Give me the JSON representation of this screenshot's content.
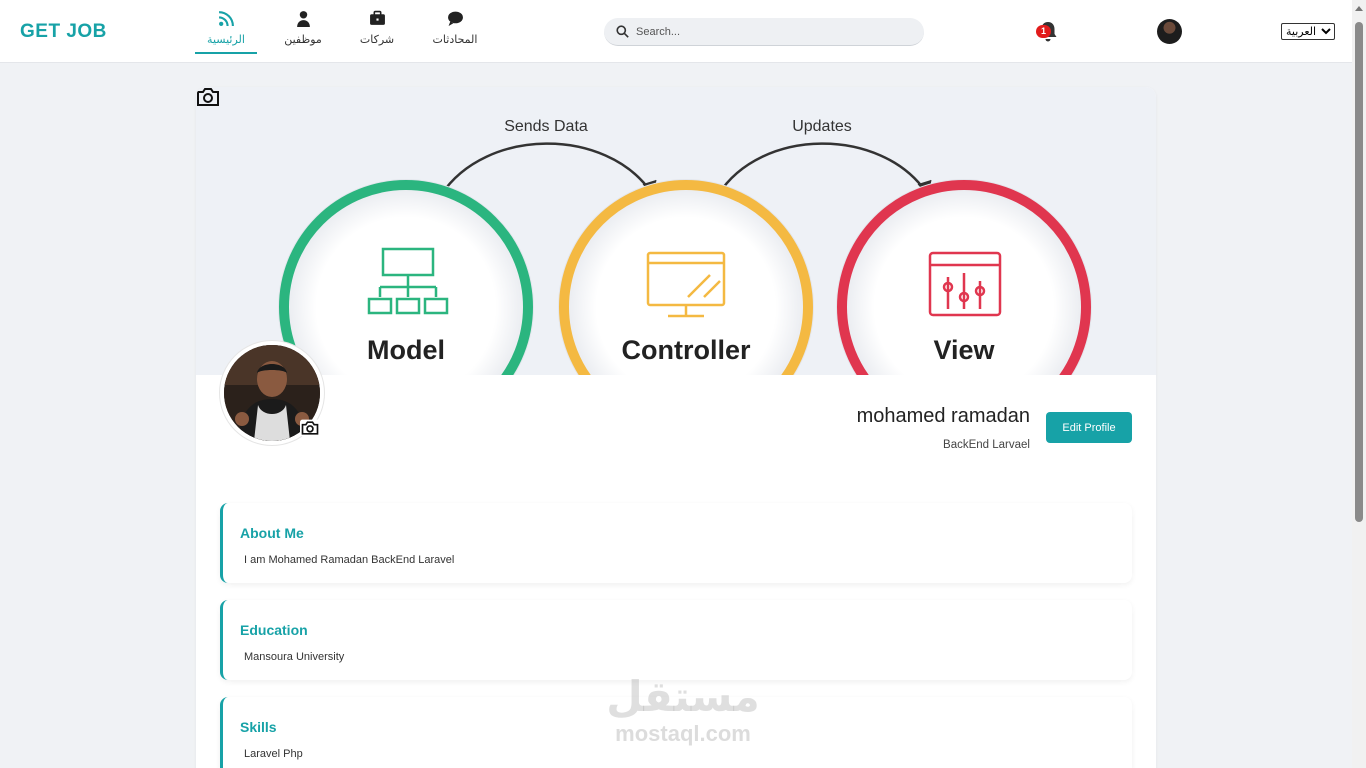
{
  "brand": "GET JOB",
  "nav": [
    {
      "label": "الرئيسية",
      "icon": "rss-icon",
      "active": true
    },
    {
      "label": "موظفين",
      "icon": "users-icon",
      "active": false
    },
    {
      "label": "شركات",
      "icon": "briefcase-icon",
      "active": false
    },
    {
      "label": "المحادثات",
      "icon": "chat-bubble-icon",
      "active": false
    }
  ],
  "search": {
    "placeholder": "Search..."
  },
  "notifications": {
    "count": "1"
  },
  "language": {
    "selected": "العربية"
  },
  "cover": {
    "labels": [
      "Sends Data",
      "Updates"
    ],
    "nodes": [
      "Model",
      "Controller",
      "View"
    ]
  },
  "profile": {
    "name": "mohamed ramadan",
    "role": "BackEnd Larvael",
    "edit_label": "Edit Profile"
  },
  "sections": [
    {
      "title": "About Me",
      "text": "I am Mohamed Ramadan BackEnd Laravel"
    },
    {
      "title": "Education",
      "text": "Mansoura University"
    },
    {
      "title": "Skills",
      "text": "Laravel Php"
    }
  ],
  "watermark": {
    "arabic": "مستقل",
    "latin": "mostaql.com"
  },
  "colors": {
    "accent": "#17a2a7",
    "badge": "#e21b1b",
    "model": "#2bb57f",
    "controller": "#f4b942",
    "view": "#e0364f"
  }
}
